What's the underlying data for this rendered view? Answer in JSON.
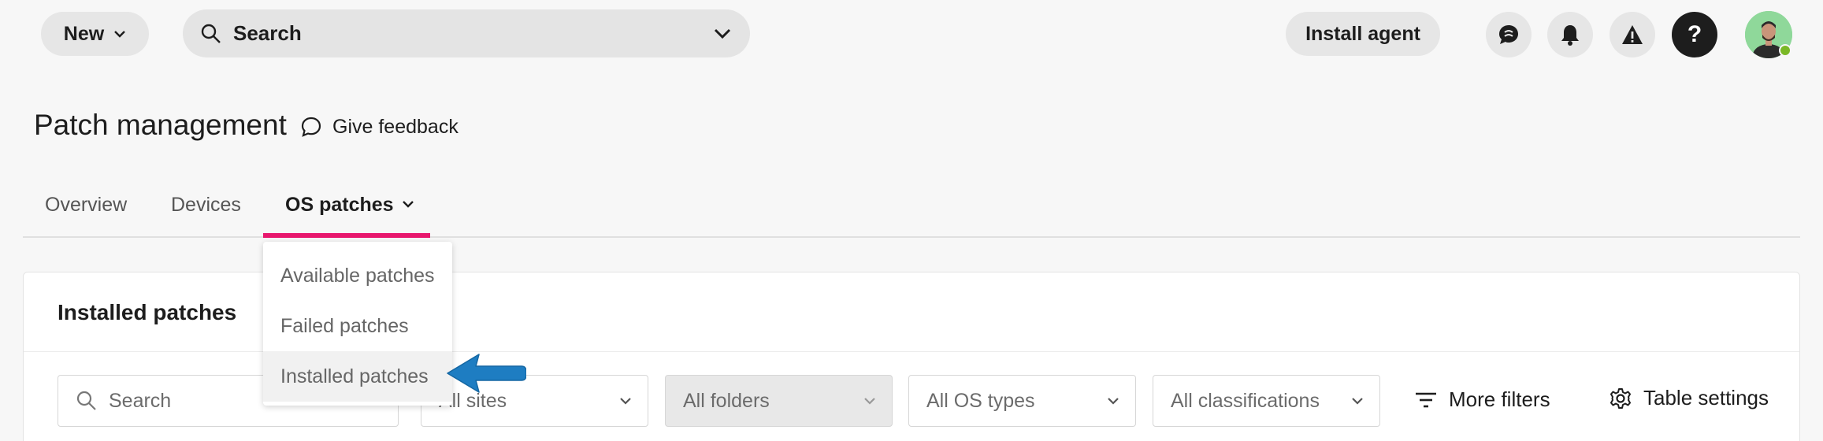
{
  "topbar": {
    "new_label": "New",
    "search_label": "Search",
    "install_label": "Install agent",
    "icons": [
      "chat-icon",
      "bell-icon",
      "warning-icon",
      "help-icon"
    ],
    "help_glyph": "?"
  },
  "header": {
    "title": "Patch management",
    "feedback_label": "Give feedback"
  },
  "tabs": [
    {
      "label": "Overview"
    },
    {
      "label": "Devices"
    },
    {
      "label": "OS patches"
    }
  ],
  "dropdown": {
    "items": [
      {
        "label": "Available patches"
      },
      {
        "label": "Failed patches"
      },
      {
        "label": "Installed patches"
      }
    ]
  },
  "card": {
    "title": "Installed patches",
    "filters": {
      "search_placeholder": "Search",
      "sites": "All sites",
      "folders": "All folders",
      "os_types": "All OS types",
      "classifications": "All classifications"
    },
    "more_filters_label": "More filters",
    "table_settings_label": "Table settings"
  },
  "colors": {
    "accent": "#e8176e",
    "arrow": "#1e7dc2",
    "status_online": "#7ab826"
  }
}
